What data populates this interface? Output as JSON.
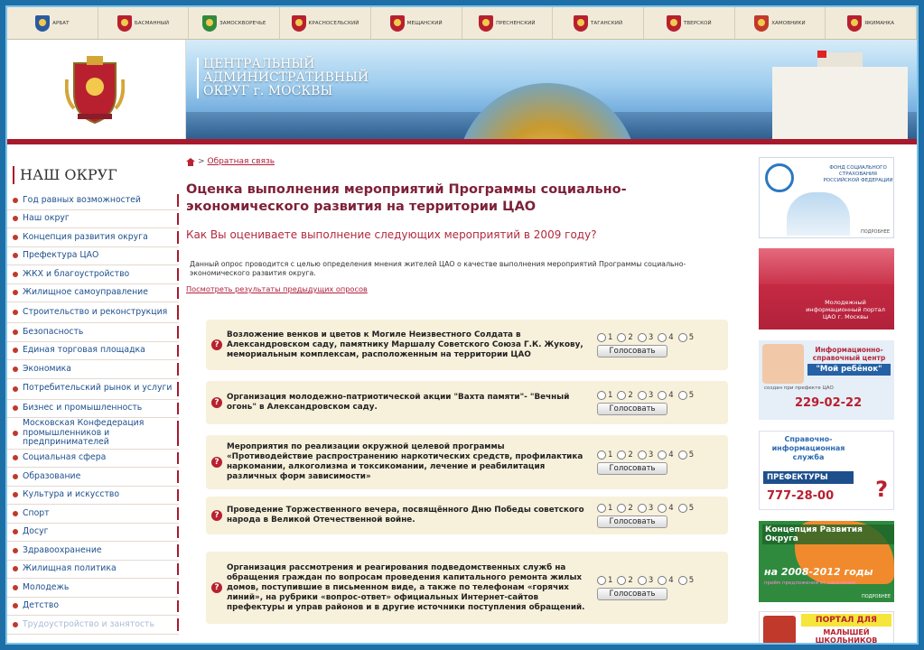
{
  "districts": [
    {
      "name": "АРБАТ"
    },
    {
      "name": "БАСМАННЫЙ"
    },
    {
      "name": "ЗАМОСКВОРЕЧЬЕ"
    },
    {
      "name": "КРАСНОСЕЛЬСКИЙ"
    },
    {
      "name": "МЕЩАНСКИЙ"
    },
    {
      "name": "ПРЕСНЕНСКИЙ"
    },
    {
      "name": "ТАГАНСКИЙ"
    },
    {
      "name": "ТВЕРСКОЙ"
    },
    {
      "name": "ХАМОВНИКИ"
    },
    {
      "name": "ЯКИМАНКА"
    }
  ],
  "banner": {
    "title_lines": [
      "ЦЕНТРАЛЬНЫЙ",
      "АДМИНИСТРАТИВНЫЙ",
      "ОКРУГ г. МОСКВЫ"
    ]
  },
  "sidebar": {
    "title": "НАШ ОКРУГ",
    "items": [
      "Год равных возможностей",
      "Наш округ",
      "Концепция развития округа",
      "Префектура ЦАО",
      "ЖКХ и благоустройство",
      "Жилищное самоуправление",
      "Строительство и реконструкция",
      "Безопасность",
      "Единая торговая площадка",
      "Экономика",
      "Потребительский рынок и услуги",
      "Бизнес и промышленность",
      "Московская Конфедерация промышленников и предпринимателей",
      "Социальная сфера",
      "Образование",
      "Культура и искусство",
      "Спорт",
      "Досуг",
      "Здравоохранение",
      "Жилищная политика",
      "Молодежь",
      "Детство",
      "Трудоустройство и занятость"
    ]
  },
  "breadcrumb": {
    "separator": ">",
    "link": "Обратная связь"
  },
  "main": {
    "title": "Оценка выполнения мероприятий Программы социально-экономического развития на территории ЦАО",
    "question": "Как Вы оцениваете выполнение следующих мероприятий в 2009 году?",
    "intro": "Данный опрос проводится с целью определения мнения жителей ЦАО о качестве выполнения мероприятий Программы социально-экономического развития округа.",
    "results_link": "Посмотреть результаты предыдущих опросов",
    "vote_label": "Голосовать",
    "rating_options": [
      "1",
      "2",
      "3",
      "4",
      "5"
    ],
    "polls": [
      "Возложение венков и цветов к Могиле Неизвестного Солдата в Александровском саду, памятнику Маршалу Советского Союза Г.К. Жукову, мемориальным комплексам, расположенным на территории ЦАО",
      "Организация молодежно-патриотической акции \"Вахта памяти\"- \"Вечный огонь\" в Александровском саду.",
      "Мероприятия по реализации окружной целевой программы «Противодействие распространению наркотических средств, профилактика наркомании, алкоголизма и токсикомании, лечение и реабилитация различных форм зависимости»",
      "Проведение Торжественного вечера, посвящённого Дню Победы советского народа в Великой Отечественной войне.",
      "Организация рассмотрения и реагирования подведомственных служб на обращения граждан по вопросам проведения капитального ремонта жилых домов, поступившие в письменном виде, а также по телефонам «горячих линий», на рубрики «вопрос-ответ» официальных Интернет-сайтов префектуры и управ районов и в другие источники поступления обращений."
    ]
  },
  "right_ads": {
    "fss": {
      "text": "ФОНД СОЦИАЛЬНОГО СТРАХОВАНИЯ РОССИЙСКОЙ ФЕДЕРАЦИИ",
      "more": "ПОДРОБНЕЕ"
    },
    "youth": {
      "text": "Молодежный информационный портал ЦАО г. Москвы"
    },
    "child": {
      "head": "Информационно-справочный центр",
      "name": "\"Мой ребёнок\"",
      "sub": "создан при префекте ЦАО",
      "phone": "229-02-22"
    },
    "prefecture": {
      "head": "Справочно-информационная служба",
      "bar": "ПРЕФЕКТУРЫ",
      "phone": "777-28-00",
      "mark": "?"
    },
    "concept": {
      "head": "Концепция Развития Округа",
      "years": "на 2008-2012 годы",
      "sub": "приём предложений от населения",
      "more": "ПОДРОБНЕЕ"
    },
    "kids_portal": {
      "head": "ПОРТАЛ ДЛЯ",
      "sub": "МАЛЫШЕЙ ШКОЛЬНИКОВ"
    }
  },
  "colors": {
    "accent": "#a8192b",
    "title": "#7d2138",
    "link": "#1d4f8c",
    "poll_bg": "#f7f0db"
  }
}
